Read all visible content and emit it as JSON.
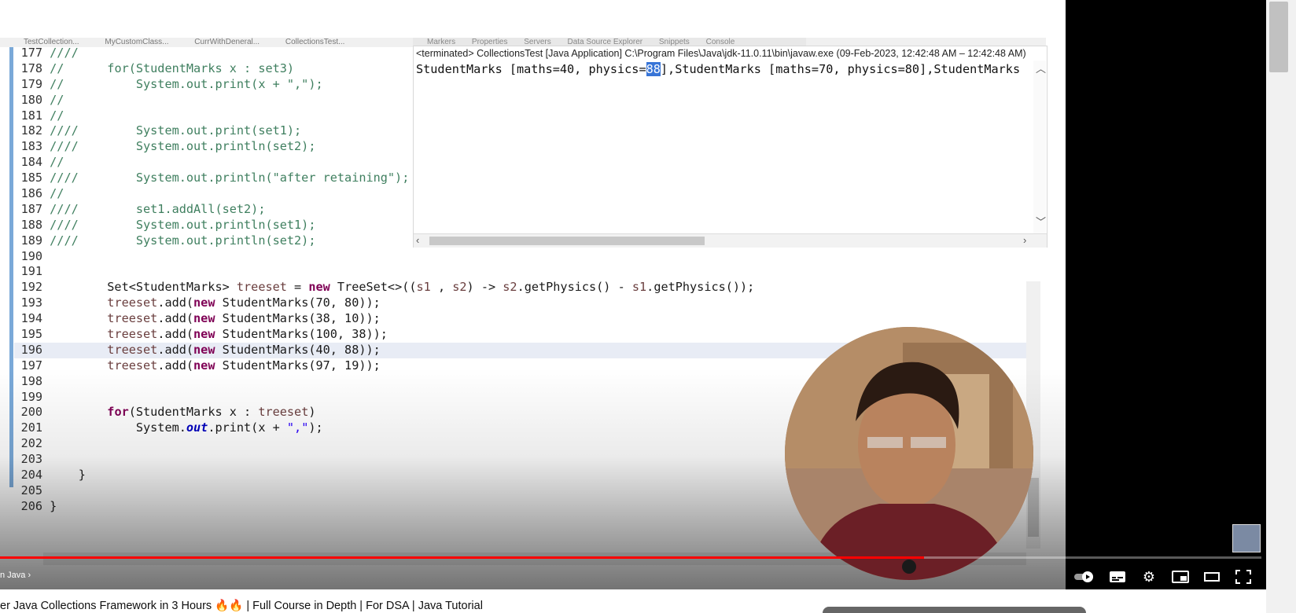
{
  "ide": {
    "tabs": [
      "TestCollection...",
      "MyCustomClass...",
      "CurrWithDeneral...",
      "CollectionsTest..."
    ],
    "console_tabs": [
      "Markers",
      "Properties",
      "Servers",
      "Data Source Explorer",
      "Snippets",
      "Console"
    ],
    "console_header": "<terminated> CollectionsTest [Java Application] C:\\Program Files\\Java\\jdk-11.0.11\\bin\\javaw.exe  (09-Feb-2023, 12:42:48 AM – 12:42:48 AM)",
    "console_output_pre": "StudentMarks [maths=40, physics=",
    "console_output_sel": "88",
    "console_output_post": "],StudentMarks [maths=70, physics=80],StudentMarks",
    "line_numbers": [
      "177",
      "178",
      "179",
      "180",
      "181",
      "182",
      "183",
      "184",
      "185",
      "186",
      "187",
      "188",
      "189",
      "190",
      "191",
      "192",
      "193",
      "194",
      "195",
      "196",
      "197",
      "198",
      "199",
      "200",
      "201",
      "202",
      "203",
      "204",
      "205",
      "206"
    ]
  },
  "player": {
    "chapter_label": "n Java",
    "controls": [
      "autoplay-toggle",
      "subtitles-icon",
      "settings-icon",
      "miniplayer-icon",
      "theater-icon",
      "fullscreen-icon"
    ]
  },
  "video_title": "er Java Collections Framework in 3 Hours 🔥🔥 | Full Course in Depth | For DSA | Java Tutorial"
}
